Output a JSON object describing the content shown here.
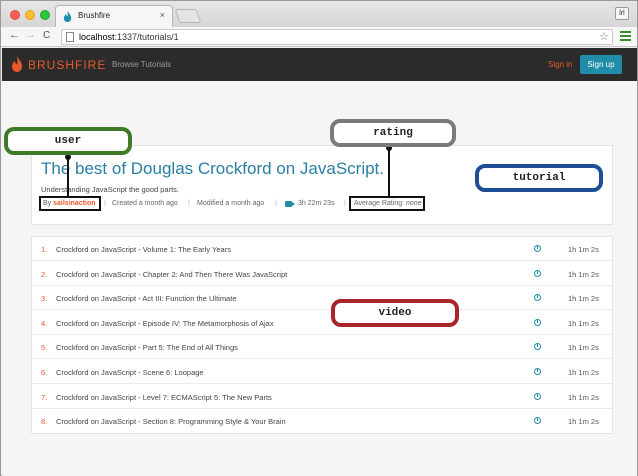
{
  "browser": {
    "tab_title": "Brushfire",
    "tab_close": "×",
    "profile_label": "lrl",
    "url_host": "localhost",
    "url_path": ":1337/tutorials/1",
    "nav_back": "←",
    "nav_forward": "→",
    "nav_reload": "C",
    "star": "☆"
  },
  "appnav": {
    "brand": "BRUSHFIRE",
    "browse": "Browse Tutorials",
    "signin": "Sign in",
    "signup": "Sign up"
  },
  "tutorial": {
    "title": "The best of Douglas Crockford on JavaScript.",
    "description": "Understanding JavaScript the good parts.",
    "by_label": "By",
    "username": "sailsinaction",
    "created": "Created a month ago",
    "modified": "Modified a month ago",
    "total_duration": "3h 22m 23s",
    "rating_label": "Average Rating:",
    "rating_value": "none",
    "separator": "|"
  },
  "videos": [
    {
      "num": "1.",
      "title": "Crockford on JavaScript - Volume 1: The Early Years",
      "duration": "1h 1m 2s"
    },
    {
      "num": "2.",
      "title": "Crockford on JavaScript - Chapter 2: And Then There Was JavaScript",
      "duration": "1h 1m 2s"
    },
    {
      "num": "3.",
      "title": "Crockford on JavaScript - Act III: Function the Ultimate",
      "duration": "1h 1m 2s"
    },
    {
      "num": "4.",
      "title": "Crockford on JavaScript - Episode IV: The Metamorphosis of Ajax",
      "duration": "1h 1m 2s"
    },
    {
      "num": "5.",
      "title": "Crockford on JavaScript - Part 5: The End of All Things",
      "duration": "1h 1m 2s"
    },
    {
      "num": "6.",
      "title": "Crockford on JavaScript - Scene 6: Loopage",
      "duration": "1h 1m 2s"
    },
    {
      "num": "7.",
      "title": "Crockford on JavaScript - Level 7: ECMAScript 5: The New Parts",
      "duration": "1h 1m 2s"
    },
    {
      "num": "8.",
      "title": "Crockford on JavaScript - Section 8: Programming Style & Your Brain",
      "duration": "1h 1m 2s"
    }
  ],
  "annotations": {
    "user": "user",
    "rating": "rating",
    "tutorial": "tutorial",
    "video": "video"
  },
  "colors": {
    "brand_orange": "#e8592b",
    "title_blue": "#2a7fa3",
    "accent_teal": "#1f8ca8",
    "user_green": "#3f7a26",
    "rating_gray": "#7a7a7a",
    "tutorial_blue": "#1e4f96",
    "video_red": "#a8262a"
  },
  "icons": [
    "flame-logo-icon",
    "clock-icon",
    "video-camera-icon",
    "star-icon",
    "menu-icon",
    "page-icon"
  ]
}
